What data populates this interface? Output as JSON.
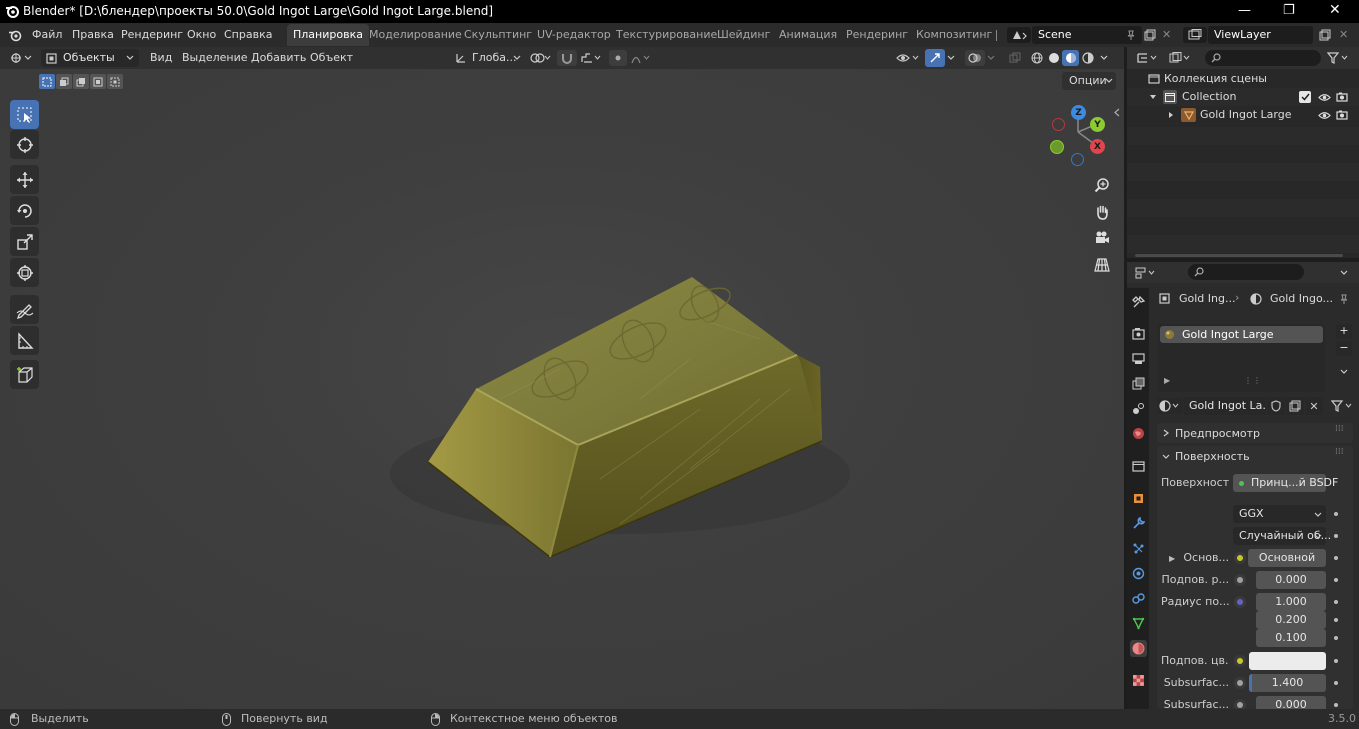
{
  "window": {
    "title": "Blender* [D:\\блендер\\проекты 50.0\\Gold Ingot Large\\Gold Ingot Large.blend]",
    "minimize": "—",
    "maximize": "❐",
    "close": "✕"
  },
  "menu": {
    "file": "Файл",
    "edit": "Правка",
    "render": "Рендеринг",
    "window": "Окно",
    "help": "Справка"
  },
  "workspaces": [
    "Планировка",
    "Моделирование",
    "Скульптинг",
    "UV-редактор",
    "Текстурирование",
    "Шейдинг",
    "Анимация",
    "Рендеринг",
    "Композитинг"
  ],
  "scene": {
    "name": "Scene",
    "view_layer": "ViewLayer"
  },
  "viewport": {
    "mode": "Объекты",
    "view": "Вид",
    "select": "Выделение",
    "add": "Добавить",
    "object": "Объект",
    "transform": "Глоба...",
    "options": "Опции",
    "gizmo": {
      "x": "X",
      "y": "Y",
      "z": "Z"
    }
  },
  "outliner": {
    "root": "Коллекция сцены",
    "collection": "Collection",
    "object": "Gold Ingot Large"
  },
  "properties": {
    "breadcrumb_object": "Gold Ing...",
    "breadcrumb_material": "Gold Ingo...",
    "slot": "Gold Ingot Large",
    "material_name": "Gold Ingot La...",
    "preview": "Предпросмотр",
    "surface_panel": "Поверхность",
    "surface_label": "Поверхность",
    "surface_value": "Принц...й BSDF",
    "distribution": "GGX",
    "subsurface_method": "Случайный об...",
    "base_label": "Основ...",
    "base_value": "Основной цвет",
    "ss_weight_label": "Подпов. р...",
    "ss_weight": "0.000",
    "ss_radius_label": "Радиус по...",
    "ss_radius": [
      "1.000",
      "0.200",
      "0.100"
    ],
    "ss_color_label": "Подпов. цв...",
    "ss_ior_label": "Subsurfac...",
    "ss_ior": "1.400",
    "ss_ior_fill": 0.04,
    "ss_aniso_label": "Subsurfac...",
    "ss_aniso": "0.000"
  },
  "status": {
    "select": "Выделить",
    "rotate": "Повернуть вид",
    "context": "Контекстное меню объектов",
    "version": "3.5.0"
  },
  "colors": {
    "accent": "#4772b3",
    "gizmo_x": "#e0444c",
    "gizmo_y": "#8bcc2e",
    "gizmo_z": "#3d8be0",
    "socket_yellow": "#c7c729",
    "socket_purple": "#6363c7",
    "socket_green": "#4ec44e",
    "socket_grey": "#a1a1a1"
  }
}
